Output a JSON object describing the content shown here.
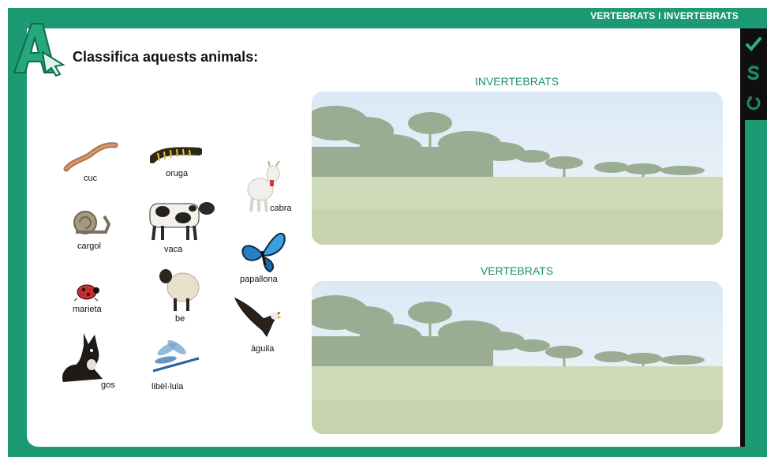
{
  "header": {
    "title": "VERTEBRATS I INVERTEBRATS"
  },
  "instruction": "Classifica aquests animals:",
  "zones": {
    "invertebrates": "INVERTEBRATS",
    "vertebrates": "VERTEBRATS"
  },
  "toolbar": [
    {
      "name": "check",
      "icon": "check-icon"
    },
    {
      "name": "solution",
      "icon": "solution-s-icon"
    },
    {
      "name": "reset",
      "icon": "reset-icon"
    }
  ],
  "animals": {
    "cuc": "cuc",
    "oruga": "oruga",
    "cabra": "cabra",
    "cargol": "cargol",
    "vaca": "vaca",
    "papallona": "papallona",
    "marieta": "marieta",
    "be": "be",
    "aguila": "àguila",
    "gos": "gos",
    "libellula": "libèl·lula"
  },
  "colors": {
    "brand_green": "#1b9a73",
    "zone_title": "#188f6c",
    "toolbar": "#0f0f0f"
  }
}
